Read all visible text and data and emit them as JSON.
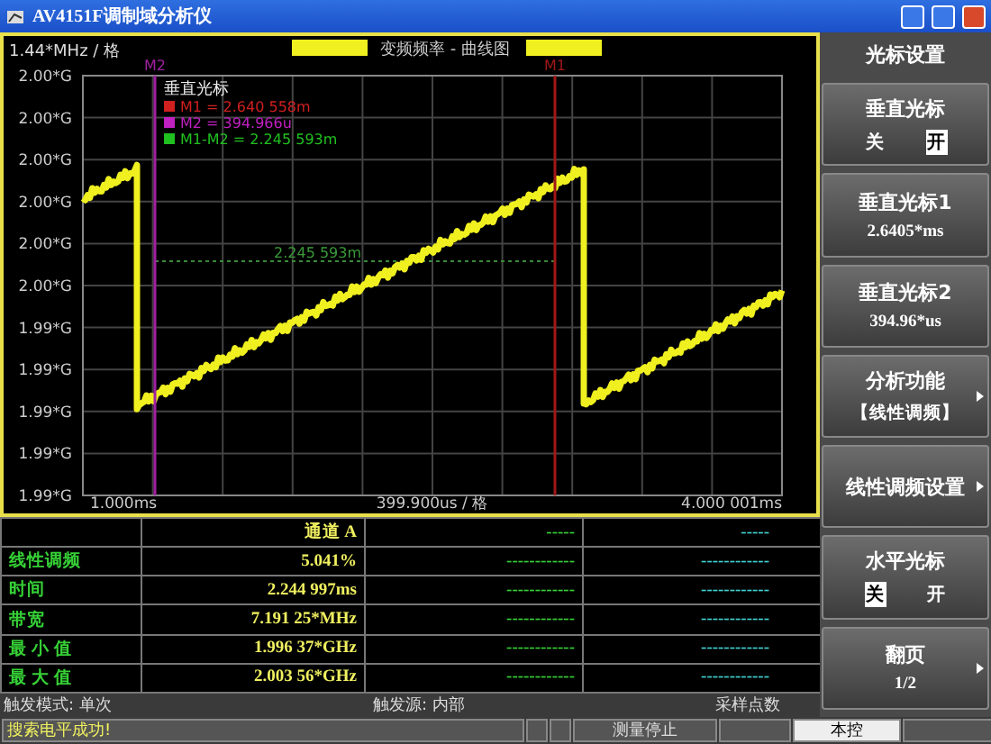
{
  "window": {
    "title": "AV4151F调制域分析仪"
  },
  "plot": {
    "scale_label": "1.44*MHz / 格",
    "title": "变频频率 - 曲线图",
    "y_labels": [
      "2.00*G",
      "2.00*G",
      "2.00*G",
      "2.00*G",
      "2.00*G",
      "2.00*G",
      "1.99*G",
      "1.99*G",
      "1.99*G",
      "1.99*G",
      "1.99*G"
    ],
    "x_start": "1.000ms",
    "x_per_div": "399.900us / 格",
    "x_end": "4.000 001ms",
    "legend_title": "垂直光标",
    "legend": [
      {
        "label": "M1 = 2.640 558m",
        "color": "#d02020"
      },
      {
        "label": "M2 = 394.966u",
        "color": "#c020c0"
      },
      {
        "label": "M1-M2 = 2.245 593m",
        "color": "#20c020"
      }
    ],
    "markers": [
      {
        "label": "M2",
        "color": "#a020a0"
      },
      {
        "label": "M1",
        "color": "#a01818"
      }
    ],
    "delta_label": "2.245 593m"
  },
  "table": {
    "header": [
      "通道 A",
      "-----",
      "-----"
    ],
    "rows": [
      {
        "label": "线性调频",
        "cells": [
          "5.041%",
          "------------",
          "------------"
        ]
      },
      {
        "label": "时间",
        "cells": [
          "2.244 997ms",
          "------------",
          "------------"
        ]
      },
      {
        "label": "带宽",
        "cells": [
          "7.191 25*MHz",
          "------------",
          "------------"
        ]
      },
      {
        "label": "最 小 值",
        "cells": [
          "1.996 37*GHz",
          "------------",
          "------------"
        ]
      },
      {
        "label": "最 大 值",
        "cells": [
          "2.003 56*GHz",
          "------------",
          "------------"
        ]
      }
    ]
  },
  "status": {
    "trigger_mode": "触发模式: 单次",
    "trigger_source": "触发源: 内部",
    "samples": "采样点数"
  },
  "bottom_bar": {
    "message": "搜索电平成功!",
    "measure": "测量停止",
    "control": "本控"
  },
  "softkeys": {
    "title": "光标设置",
    "keys": [
      {
        "kind": "toggle",
        "label": "垂直光标",
        "options": [
          {
            "label": "关",
            "selected": false
          },
          {
            "label": "开",
            "selected": true
          }
        ]
      },
      {
        "kind": "value",
        "label": "垂直光标1",
        "value": "2.6405*ms"
      },
      {
        "kind": "value",
        "label": "垂直光标2",
        "value": "394.96*us"
      },
      {
        "kind": "menu",
        "label": "分析功能",
        "value": "【线性调频】"
      },
      {
        "kind": "menu",
        "label": "线性调频设置"
      },
      {
        "kind": "toggle",
        "label": "水平光标",
        "options": [
          {
            "label": "关",
            "selected": true
          },
          {
            "label": "开",
            "selected": false
          }
        ]
      },
      {
        "kind": "menu",
        "label": "翻页",
        "value": "1/2"
      }
    ]
  }
}
